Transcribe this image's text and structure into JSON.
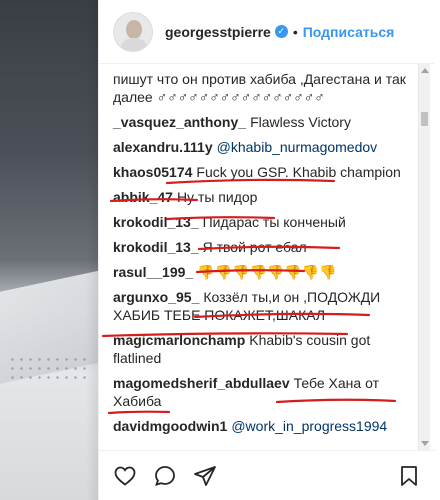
{
  "header": {
    "username": "georgesstpierre",
    "separator": "•",
    "follow_label": "Подписаться"
  },
  "comments": [
    {
      "author": "",
      "text": "пишут что он против хабиба ,Дагестана и так далее ♂♂♂♂♂♂♂♂♂♂♂♂♂♂♂♂",
      "mention": ""
    },
    {
      "author": "_vasquez_anthony_",
      "text": "Flawless Victory",
      "mention": ""
    },
    {
      "author": "alexandru.111y",
      "text": "",
      "mention": "@khabib_nurmagomedov"
    },
    {
      "author": "khaos05174",
      "text": "Fuck you GSP. Khabib champion",
      "mention": ""
    },
    {
      "author": "abbik_47",
      "text": "Ну ты пидор",
      "mention": ""
    },
    {
      "author": "krokodil_13_",
      "text": "Пидарас ты конченый",
      "mention": ""
    },
    {
      "author": "krokodil_13_",
      "text": "Я твой рот ебал",
      "mention": ""
    },
    {
      "author": "rasul__199_",
      "text": "👎👎👎👎👎👎👎👎",
      "mention": ""
    },
    {
      "author": "argunxo_95_",
      "text": "Коззёл ты,и он ,ПОДОЖДИ ХАБИБ ТЕБЕ ПОКАЖЕТ,ШАКАЛ",
      "mention": ""
    },
    {
      "author": "magicmarlonchamp",
      "text": "Khabib's cousin got flatlined",
      "mention": ""
    },
    {
      "author": "magomedsherif_abdullaev",
      "text": "Тебе Хана от Хабиба",
      "mention": ""
    },
    {
      "author": "davidmgoodwin1",
      "text": "",
      "mention": "@work_in_progress1994"
    }
  ],
  "icons": {
    "like": "heart-icon",
    "comment": "comment-icon",
    "share": "share-icon",
    "save": "bookmark-icon"
  },
  "colors": {
    "follow": "#3897f0",
    "mention": "#003569",
    "annotation": "#d61d1d"
  }
}
